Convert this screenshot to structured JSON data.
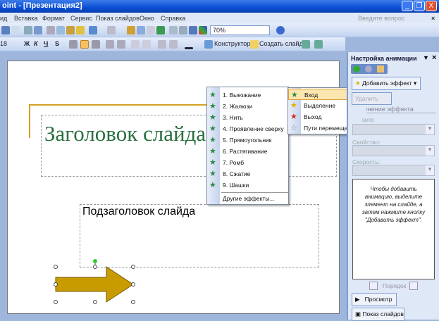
{
  "window": {
    "title": "oint - [Презентация2]",
    "minimize": "_",
    "restore": "❐",
    "close": "X"
  },
  "menu": [
    "ид",
    "Вставка",
    "Формат",
    "Сервис",
    "Показ слайдов",
    "Окно",
    "Справка"
  ],
  "help_box": {
    "placeholder": "Введите вопрос",
    "close": "×"
  },
  "toolbar": {
    "zoom": "70%"
  },
  "format_toolbar": {
    "font_size": "18",
    "bold": "Ж",
    "italic": "К",
    "underline": "Ч",
    "shadow": "S",
    "designer": "Конструктор",
    "new_slide": "Создать слайд"
  },
  "slide": {
    "title": "Заголовок слайда",
    "subtitle": "Подзаголовок слайда",
    "arrow_color": "#c89b00"
  },
  "entry_menu": {
    "items": [
      "1. Выезжание",
      "2. Жалюзи",
      "3. Нить",
      "4. Проявление сверху",
      "5. Прямоугольник",
      "6. Растягивание",
      "7. Ромб",
      "8. Сжатие",
      "9. Шашки"
    ],
    "more": "Другие эффекты..."
  },
  "effect_menu": {
    "items": [
      {
        "label": "Вход",
        "arrow": "▶"
      },
      {
        "label": "Выделение",
        "arrow": ""
      },
      {
        "label": "Выход",
        "arrow": ""
      },
      {
        "label": "Пути перемещения",
        "arrow": "▶"
      }
    ]
  },
  "pane": {
    "title": "Настройка анимации",
    "add_effect": "Добавить эффект",
    "remove": "Удалить",
    "change_heading": "Изменение эффекта",
    "start_label": "Начало:",
    "property_label": "Свойство:",
    "speed_label": "Скорость:",
    "hint": "Чтобы добавить анимацию, выделите элемент на слайде, а затем нажмите кнопку \"Добавить эффект\".",
    "order": "Порядок",
    "preview": "Просмотр",
    "slideshow": "Показ слайдов"
  }
}
